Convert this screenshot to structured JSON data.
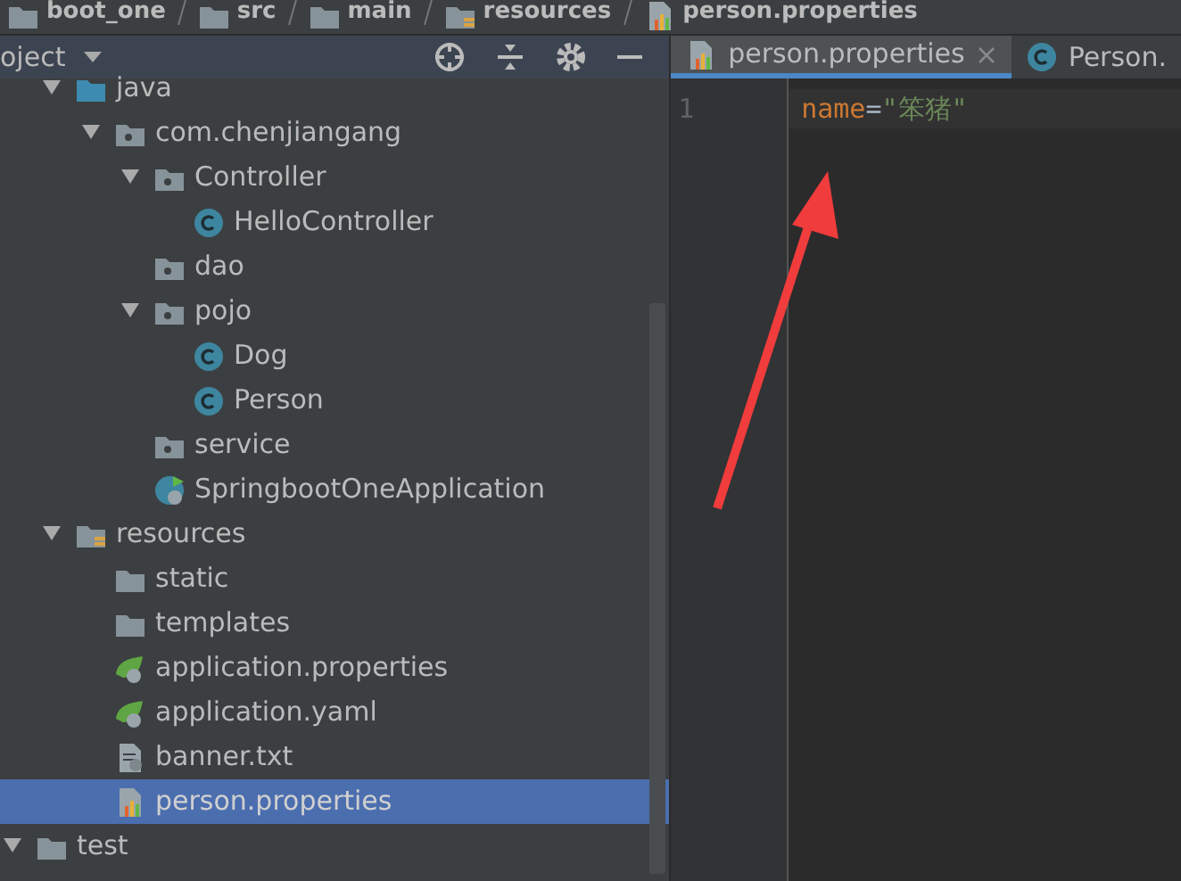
{
  "breadcrumb": [
    {
      "label": "boot_one",
      "kind": "module"
    },
    {
      "label": "src",
      "kind": "folder"
    },
    {
      "label": "main",
      "kind": "folder"
    },
    {
      "label": "resources",
      "kind": "resources-root"
    },
    {
      "label": "person.properties",
      "kind": "properties-file"
    }
  ],
  "project_panel": {
    "title": "oject",
    "tree": [
      {
        "children": [
          {
            "label": "java",
            "kind": "source-root",
            "expanded": true,
            "selected": false,
            "children": [
              {
                "label": "com.chenjiangang",
                "kind": "package",
                "expanded": true,
                "selected": false,
                "children": [
                  {
                    "label": "Controller",
                    "kind": "package",
                    "expanded": true,
                    "selected": false,
                    "children": [
                      {
                        "label": "HelloController",
                        "kind": "class",
                        "selected": false
                      }
                    ]
                  },
                  {
                    "label": "dao",
                    "kind": "package",
                    "selected": false
                  },
                  {
                    "label": "pojo",
                    "kind": "package",
                    "expanded": true,
                    "selected": false,
                    "children": [
                      {
                        "label": "Dog",
                        "kind": "class",
                        "selected": false
                      },
                      {
                        "label": "Person",
                        "kind": "class",
                        "selected": false
                      }
                    ]
                  },
                  {
                    "label": "service",
                    "kind": "package",
                    "selected": false
                  },
                  {
                    "label": "SpringbootOneApplication",
                    "kind": "spring-app",
                    "selected": false
                  }
                ]
              }
            ]
          },
          {
            "label": "resources",
            "kind": "resources-root",
            "expanded": true,
            "selected": false,
            "children": [
              {
                "label": "static",
                "kind": "folder",
                "selected": false
              },
              {
                "label": "templates",
                "kind": "folder",
                "selected": false
              },
              {
                "label": "application.properties",
                "kind": "spring-config",
                "selected": false
              },
              {
                "label": "application.yaml",
                "kind": "spring-config",
                "selected": false
              },
              {
                "label": "banner.txt",
                "kind": "text-file",
                "selected": false
              },
              {
                "label": "person.properties",
                "kind": "properties-file",
                "selected": true
              }
            ]
          }
        ]
      },
      {
        "label": "test",
        "kind": "folder",
        "expanded": true,
        "selected": false
      }
    ]
  },
  "editor": {
    "tabs": [
      {
        "label": "person.properties",
        "kind": "properties-file",
        "selected": true,
        "closable": true
      },
      {
        "label": "Person.",
        "kind": "class",
        "selected": false
      }
    ],
    "lines": [
      {
        "number": "1",
        "key": "name",
        "separator": "=",
        "value": "\"笨猪\""
      }
    ]
  }
}
